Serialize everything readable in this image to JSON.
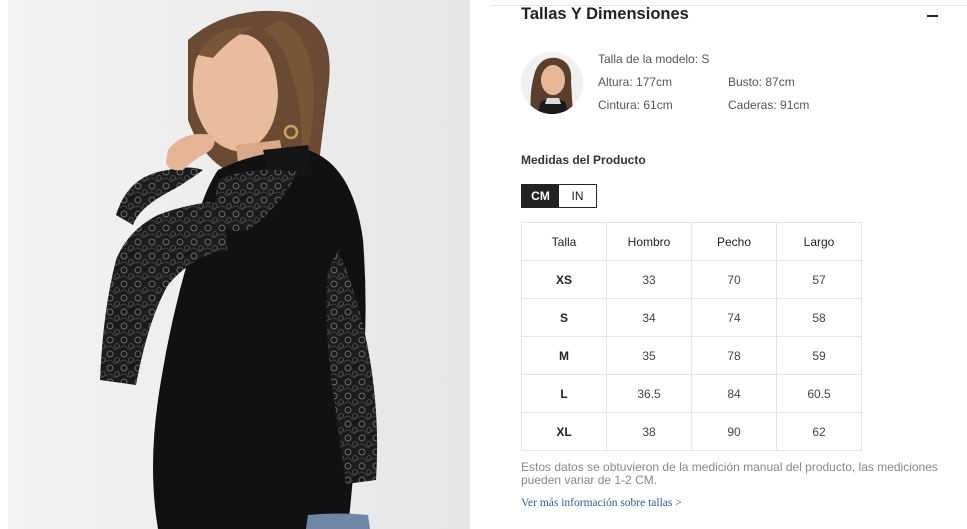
{
  "section": {
    "title": "Tallas Y Dimensiones"
  },
  "model": {
    "size": "Talla de la modelo: S",
    "height": "Altura: 177cm",
    "bust": "Busto: 87cm",
    "waist": "Cintura: 61cm",
    "hips": "Caderas: 91cm"
  },
  "measurements": {
    "title": "Medidas del Producto",
    "units": [
      "CM",
      "IN"
    ],
    "active_unit": "CM",
    "columns": [
      "Talla",
      "Hombro",
      "Pecho",
      "Largo"
    ],
    "rows": [
      [
        "XS",
        "33",
        "70",
        "57"
      ],
      [
        "S",
        "34",
        "74",
        "58"
      ],
      [
        "M",
        "35",
        "78",
        "59"
      ],
      [
        "L",
        "36.5",
        "84",
        "60.5"
      ],
      [
        "XL",
        "38",
        "90",
        "62"
      ]
    ]
  },
  "note": "Estos datos se obtuvieron de la medición manual del producto, las mediciones pueden variar de 1-2 CM.",
  "more_link": "Ver más información sobre tallas >",
  "colors": {
    "text": "#222222",
    "link": "#2b5d9e",
    "muted": "#888888",
    "border": "#e5e5e5"
  }
}
